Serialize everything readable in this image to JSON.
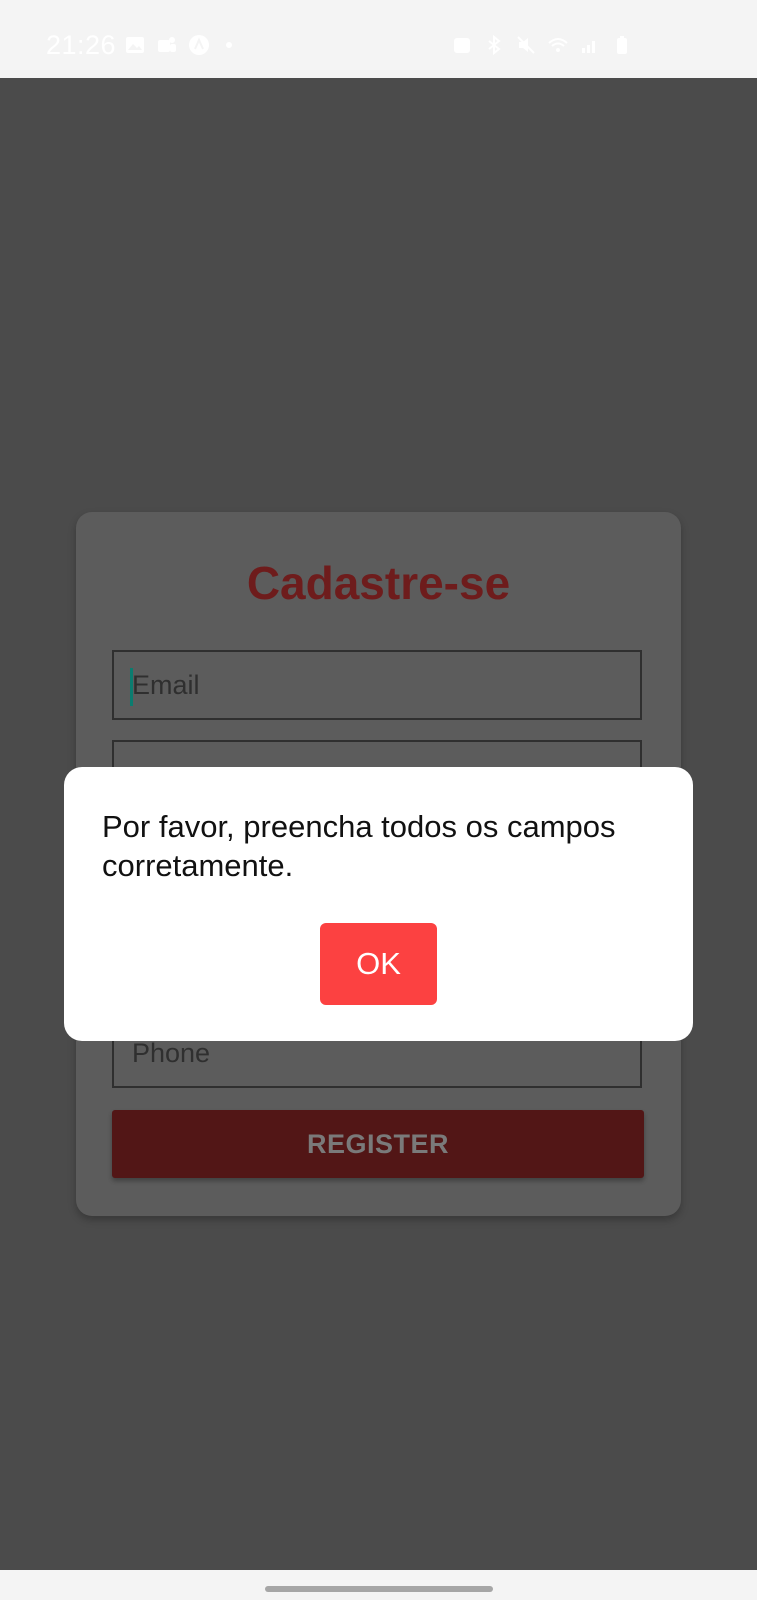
{
  "status_bar": {
    "time": "21:26",
    "left_icons": [
      "gallery-icon",
      "teams-icon",
      "app-icon"
    ],
    "right_icons": [
      "alarm-icon",
      "bluetooth-icon",
      "mute-icon",
      "wifi-icon",
      "signal-icon",
      "battery-icon"
    ]
  },
  "register_form": {
    "title": "Cadastre-se",
    "email_placeholder": "Email",
    "phone_placeholder": "Phone",
    "register_label": "REGISTER"
  },
  "alert_dialog": {
    "message": "Por favor, preencha todos os campos corretamente.",
    "ok_label": "OK"
  },
  "colors": {
    "accent": "#fc4141",
    "title": "#6e1c1c",
    "register_button": "#521616",
    "scrim": "#4b4b4b"
  }
}
